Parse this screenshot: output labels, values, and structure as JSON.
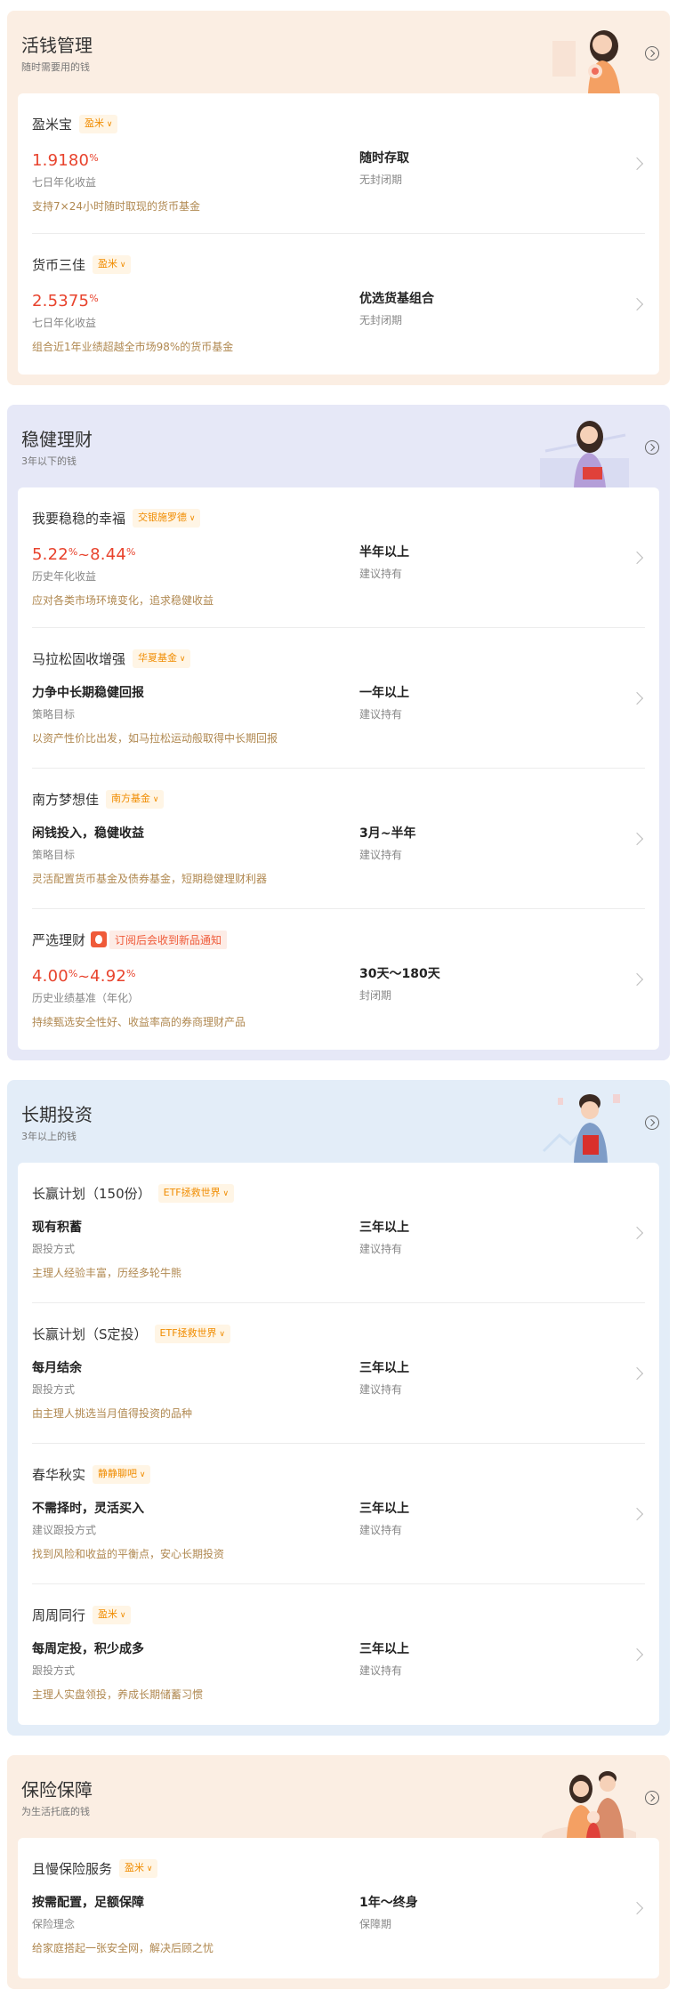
{
  "sections": [
    {
      "title": "活钱管理",
      "subtitle": "随时需要用的钱",
      "items": [
        {
          "name": "盈米宝",
          "tag": "盈米",
          "value_kind": "rate",
          "rate_a": "1.9180",
          "rate_b": "",
          "left_caption": "七日年化收益",
          "right_value": "随时存取",
          "right_caption": "无封闭期",
          "desc": "支持7×24小时随时取现的货币基金"
        },
        {
          "name": "货币三佳",
          "tag": "盈米",
          "value_kind": "rate",
          "rate_a": "2.5375",
          "rate_b": "",
          "left_caption": "七日年化收益",
          "right_value": "优选货基组合",
          "right_caption": "无封闭期",
          "desc": "组合近1年业绩超越全市场98%的货币基金"
        }
      ]
    },
    {
      "title": "稳健理财",
      "subtitle": "3年以下的钱",
      "items": [
        {
          "name": "我要稳稳的幸福",
          "tag": "交银施罗德",
          "value_kind": "range",
          "rate_a": "5.22",
          "rate_b": "8.44",
          "left_caption": "历史年化收益",
          "right_value": "半年以上",
          "right_caption": "建议持有",
          "desc": "应对各类市场环境变化，追求稳健收益"
        },
        {
          "name": "马拉松固收增强",
          "tag": "华夏基金",
          "value_kind": "text",
          "left_value": "力争中长期稳健回报",
          "left_caption": "策略目标",
          "right_value": "一年以上",
          "right_caption": "建议持有",
          "desc": "以资产性价比出发，如马拉松运动般取得中长期回报"
        },
        {
          "name": "南方梦想佳",
          "tag": "南方基金",
          "value_kind": "text",
          "left_value": "闲钱投入，稳健收益",
          "left_caption": "策略目标",
          "right_value": "3月~半年",
          "right_caption": "建议持有",
          "desc": "灵活配置货币基金及债券基金，短期稳健理财利器"
        },
        {
          "name": "严选理财",
          "notice": "订阅后会收到新品通知",
          "value_kind": "range",
          "rate_a": "4.00",
          "rate_b": "4.92",
          "left_caption": "历史业绩基准（年化）",
          "right_value": "30天～180天",
          "right_caption": "封闭期",
          "desc": "持续甄选安全性好、收益率高的券商理财产品"
        }
      ]
    },
    {
      "title": "长期投资",
      "subtitle": "3年以上的钱",
      "items": [
        {
          "name": "长赢计划（150份）",
          "tag": "ETF拯救世界",
          "value_kind": "text",
          "left_value": "现有积蓄",
          "left_caption": "跟投方式",
          "right_value": "三年以上",
          "right_caption": "建议持有",
          "desc": "主理人经验丰富，历经多轮牛熊"
        },
        {
          "name": "长赢计划（S定投）",
          "tag": "ETF拯救世界",
          "value_kind": "text",
          "left_value": "每月结余",
          "left_caption": "跟投方式",
          "right_value": "三年以上",
          "right_caption": "建议持有",
          "desc": "由主理人挑选当月值得投资的品种"
        },
        {
          "name": "春华秋实",
          "tag": "静静聊吧",
          "value_kind": "text",
          "left_value": "不需择时，灵活买入",
          "left_caption": "建议跟投方式",
          "right_value": "三年以上",
          "right_caption": "建议持有",
          "desc": "找到风险和收益的平衡点，安心长期投资"
        },
        {
          "name": "周周同行",
          "tag": "盈米",
          "value_kind": "text",
          "left_value": "每周定投，积少成多",
          "left_caption": "跟投方式",
          "right_value": "三年以上",
          "right_caption": "建议持有",
          "desc": "主理人实盘领投，养成长期储蓄习惯"
        }
      ]
    },
    {
      "title": "保险保障",
      "subtitle": "为生活托底的钱",
      "items": [
        {
          "name": "且慢保险服务",
          "tag": "盈米",
          "value_kind": "text",
          "left_value": "按需配置，足额保障",
          "left_caption": "保险理念",
          "right_value": "1年～终身",
          "right_caption": "保障期",
          "desc": "给家庭搭起一张安全网，解决后顾之忧"
        }
      ]
    }
  ],
  "percent_sign": "%",
  "range_sep": "~"
}
